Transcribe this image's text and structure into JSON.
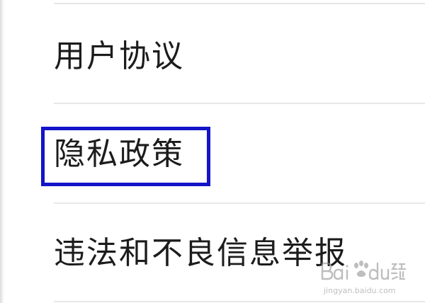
{
  "settings_list": {
    "items": [
      {
        "label": "用户协议"
      },
      {
        "label": "隐私政策",
        "highlighted": true
      },
      {
        "label": "违法和不良信息举报"
      }
    ]
  },
  "highlight": {
    "color": "#1414c8"
  },
  "watermark": {
    "brand": "Baidu",
    "subtitle_cn": "经验",
    "url": "jingyan.baidu.com"
  }
}
